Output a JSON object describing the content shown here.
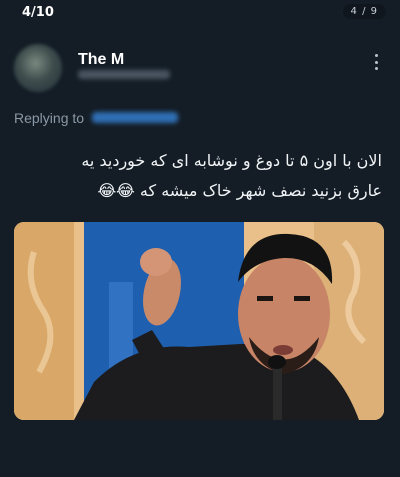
{
  "viewer": {
    "counter": "4/10",
    "page_indicator": "4 / 9"
  },
  "tweet": {
    "author_name": "The M",
    "replying_label": "Replying to",
    "text_line1": "الان با اون ۵ تا دوغ و نوشابه ای که خوردید یه",
    "text_line2": "عارق بزنید نصف شهر خاک میشه که 😂😂",
    "media_icon": "photo-of-man-gesturing-at-microphone"
  },
  "icons": {
    "more": "vertical-ellipsis-icon"
  },
  "colors": {
    "background": "#141d26",
    "link": "#1d9bf0",
    "muted": "#8b98a5"
  }
}
